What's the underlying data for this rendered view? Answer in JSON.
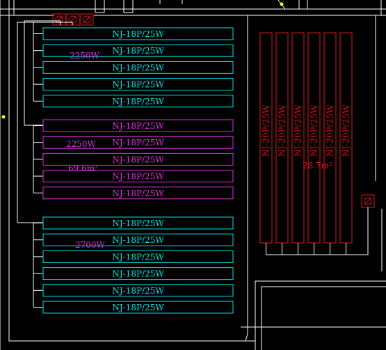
{
  "drawing": {
    "colors": {
      "background": "#000000",
      "walls": "#ffffff",
      "wiring": "#ffffff",
      "cyan_group": "#00e5e5",
      "magenta_group": "#e030e0",
      "red_group": "#e01818",
      "symbols": "#e01818",
      "marker": "#ffff00"
    },
    "groups": [
      {
        "id": "group-1",
        "color": "cyan_group",
        "power_label": "2250W",
        "area_label": "",
        "heaters": [
          "NJ-18P/25W",
          "NJ-18P/25W",
          "NJ-18P/25W",
          "NJ-18P/25W",
          "NJ-18P/25W"
        ]
      },
      {
        "id": "group-2",
        "color": "magenta_group",
        "power_label": "2250W",
        "area_label": "69.6m²",
        "heaters": [
          "NJ-18P/25W",
          "NJ-18P/25W",
          "NJ-18P/25W",
          "NJ-18P/25W",
          "NJ-18P/25W"
        ]
      },
      {
        "id": "group-3",
        "color": "cyan_group",
        "power_label": "2700W",
        "area_label": "",
        "heaters": [
          "NJ-18P/25W",
          "NJ-18P/25W",
          "NJ-18P/25W",
          "NJ-18P/25W",
          "NJ-18P/25W",
          "NJ-18P/25W"
        ]
      }
    ],
    "vertical_group": {
      "color": "red_group",
      "area_label": "28.7m²",
      "heaters": [
        "NJ-20P/25W",
        "NJ-20P/25W",
        "NJ-20P/25W",
        "NJ-20P/25W",
        "NJ-20P/25W",
        "NJ-20P/25W"
      ]
    }
  }
}
